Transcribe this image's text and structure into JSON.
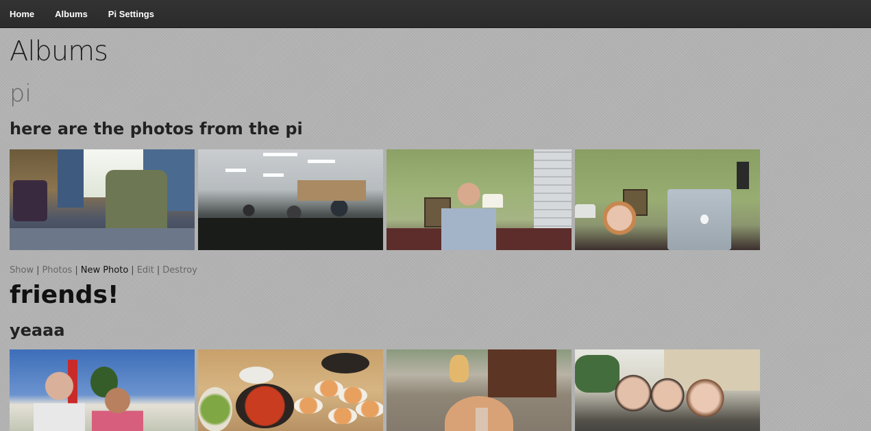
{
  "nav": {
    "items": [
      {
        "label": "Home"
      },
      {
        "label": "Albums"
      },
      {
        "label": "Pi Settings"
      }
    ]
  },
  "page": {
    "title": "Albums"
  },
  "albums": [
    {
      "name": "pi",
      "description": "here are the photos from the pi",
      "actions": {
        "show": "Show",
        "photos": "Photos",
        "new_photo": "New Photo",
        "edit": "Edit",
        "destroy": "Destroy",
        "separator": "|"
      }
    },
    {
      "name": "friends!",
      "description": "yeaaa"
    }
  ]
}
